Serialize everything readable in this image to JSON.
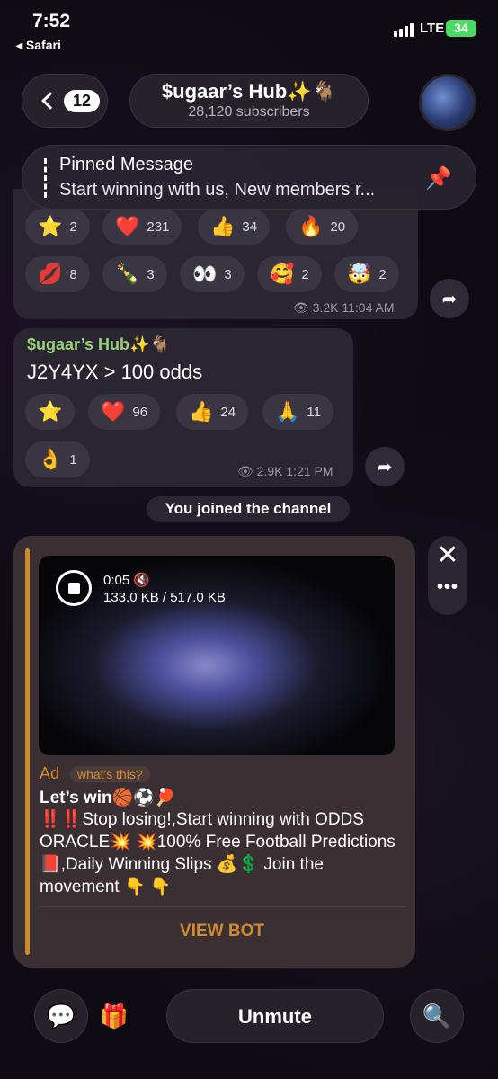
{
  "status_bar": {
    "time": "7:52",
    "back_app": "◂ Safari",
    "network": "LTE",
    "battery": "34"
  },
  "header": {
    "back_count": "12",
    "title": "$ugaar’s Hub✨🐐",
    "subtitle": "28,120 subscribers"
  },
  "pinned": {
    "label": "Pinned Message",
    "text": "Start winning with us, New members r..."
  },
  "message1": {
    "reactions_row1": [
      {
        "emoji": "⭐",
        "count": "2"
      },
      {
        "emoji": "❤️",
        "count": "231"
      },
      {
        "emoji": "👍",
        "count": "34"
      },
      {
        "emoji": "🔥",
        "count": "20"
      }
    ],
    "reactions_row2": [
      {
        "emoji": "💋",
        "count": "8"
      },
      {
        "emoji": "🍾",
        "count": "3"
      },
      {
        "emoji": "👀",
        "count": "3"
      },
      {
        "emoji": "🥰",
        "count": "2"
      },
      {
        "emoji": "🤯",
        "count": "2"
      }
    ],
    "views": "3.2K",
    "time": "11:04 AM"
  },
  "message2": {
    "sender": "$ugaar’s Hub✨🐐",
    "text": "J2Y4YX  > 100 odds",
    "reactions": [
      {
        "emoji": "⭐",
        "count": ""
      },
      {
        "emoji": "❤️",
        "count": "96"
      },
      {
        "emoji": "👍",
        "count": "24"
      },
      {
        "emoji": "🙏",
        "count": "11"
      },
      {
        "emoji": "👌",
        "count": "1"
      }
    ],
    "views": "2.9K",
    "time": "1:21 PM"
  },
  "service": {
    "text": "You joined the channel"
  },
  "ad": {
    "video_time": "0:05",
    "video_size": "133.0 KB / 517.0 KB",
    "label": "Ad",
    "whats_this": "what's this?",
    "title": "Let’s win🏀⚽🏓",
    "body": "‼️‼️Stop losing!,Start winning with ODDS ORACLE💥 💥100% Free Football Predictions📕,Daily Winning Slips 💰💲 Join the movement 👇 👇",
    "cta": "VIEW BOT"
  },
  "bottom": {
    "unmute": "Unmute"
  }
}
